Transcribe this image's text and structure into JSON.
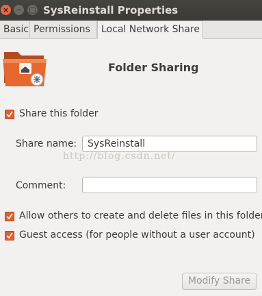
{
  "window": {
    "title": "SysReinstall Properties",
    "close_glyph": "×",
    "minimize_glyph": "−",
    "maximize_glyph": "□"
  },
  "tabs": [
    {
      "label": "Basic"
    },
    {
      "label": "Permissions"
    },
    {
      "label": "Local Network Share",
      "active": true
    }
  ],
  "header": {
    "heading": "Folder Sharing",
    "icon": "shared-folder-icon"
  },
  "share_checkbox": {
    "label": "Share this folder",
    "checked": true
  },
  "share_name": {
    "label": "Share name:",
    "value": "SysReinstall"
  },
  "comment": {
    "label": "Comment:",
    "value": ""
  },
  "options": [
    {
      "label": "Allow others to create and delete files in this folder",
      "checked": true
    },
    {
      "label": "Guest access (for people without a user account)",
      "checked": true
    }
  ],
  "watermark": "http://blog.csdn.net/",
  "actions": {
    "modify_share": "Modify Share"
  },
  "colors": {
    "accent": "#e0602c",
    "titlebar": "#3c3b37",
    "background": "#f2f1f0"
  }
}
